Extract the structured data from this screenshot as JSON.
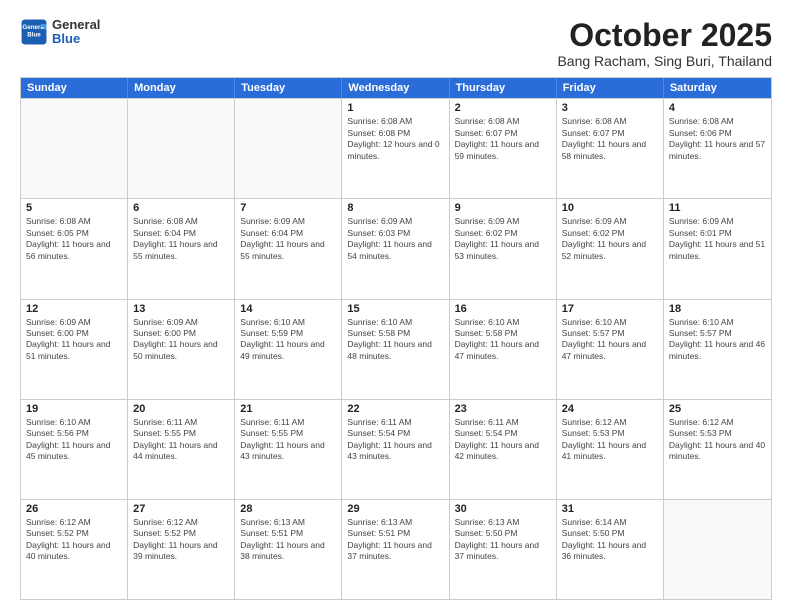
{
  "header": {
    "logo": {
      "general": "General",
      "blue": "Blue"
    },
    "title": "October 2025",
    "location": "Bang Racham, Sing Buri, Thailand"
  },
  "weekdays": [
    "Sunday",
    "Monday",
    "Tuesday",
    "Wednesday",
    "Thursday",
    "Friday",
    "Saturday"
  ],
  "weeks": [
    [
      {
        "day": "",
        "sunrise": "",
        "sunset": "",
        "daylight": "",
        "empty": true
      },
      {
        "day": "",
        "sunrise": "",
        "sunset": "",
        "daylight": "",
        "empty": true
      },
      {
        "day": "",
        "sunrise": "",
        "sunset": "",
        "daylight": "",
        "empty": true
      },
      {
        "day": "1",
        "sunrise": "Sunrise: 6:08 AM",
        "sunset": "Sunset: 6:08 PM",
        "daylight": "Daylight: 12 hours and 0 minutes.",
        "empty": false
      },
      {
        "day": "2",
        "sunrise": "Sunrise: 6:08 AM",
        "sunset": "Sunset: 6:07 PM",
        "daylight": "Daylight: 11 hours and 59 minutes.",
        "empty": false
      },
      {
        "day": "3",
        "sunrise": "Sunrise: 6:08 AM",
        "sunset": "Sunset: 6:07 PM",
        "daylight": "Daylight: 11 hours and 58 minutes.",
        "empty": false
      },
      {
        "day": "4",
        "sunrise": "Sunrise: 6:08 AM",
        "sunset": "Sunset: 6:06 PM",
        "daylight": "Daylight: 11 hours and 57 minutes.",
        "empty": false
      }
    ],
    [
      {
        "day": "5",
        "sunrise": "Sunrise: 6:08 AM",
        "sunset": "Sunset: 6:05 PM",
        "daylight": "Daylight: 11 hours and 56 minutes.",
        "empty": false
      },
      {
        "day": "6",
        "sunrise": "Sunrise: 6:08 AM",
        "sunset": "Sunset: 6:04 PM",
        "daylight": "Daylight: 11 hours and 55 minutes.",
        "empty": false
      },
      {
        "day": "7",
        "sunrise": "Sunrise: 6:09 AM",
        "sunset": "Sunset: 6:04 PM",
        "daylight": "Daylight: 11 hours and 55 minutes.",
        "empty": false
      },
      {
        "day": "8",
        "sunrise": "Sunrise: 6:09 AM",
        "sunset": "Sunset: 6:03 PM",
        "daylight": "Daylight: 11 hours and 54 minutes.",
        "empty": false
      },
      {
        "day": "9",
        "sunrise": "Sunrise: 6:09 AM",
        "sunset": "Sunset: 6:02 PM",
        "daylight": "Daylight: 11 hours and 53 minutes.",
        "empty": false
      },
      {
        "day": "10",
        "sunrise": "Sunrise: 6:09 AM",
        "sunset": "Sunset: 6:02 PM",
        "daylight": "Daylight: 11 hours and 52 minutes.",
        "empty": false
      },
      {
        "day": "11",
        "sunrise": "Sunrise: 6:09 AM",
        "sunset": "Sunset: 6:01 PM",
        "daylight": "Daylight: 11 hours and 51 minutes.",
        "empty": false
      }
    ],
    [
      {
        "day": "12",
        "sunrise": "Sunrise: 6:09 AM",
        "sunset": "Sunset: 6:00 PM",
        "daylight": "Daylight: 11 hours and 51 minutes.",
        "empty": false
      },
      {
        "day": "13",
        "sunrise": "Sunrise: 6:09 AM",
        "sunset": "Sunset: 6:00 PM",
        "daylight": "Daylight: 11 hours and 50 minutes.",
        "empty": false
      },
      {
        "day": "14",
        "sunrise": "Sunrise: 6:10 AM",
        "sunset": "Sunset: 5:59 PM",
        "daylight": "Daylight: 11 hours and 49 minutes.",
        "empty": false
      },
      {
        "day": "15",
        "sunrise": "Sunrise: 6:10 AM",
        "sunset": "Sunset: 5:58 PM",
        "daylight": "Daylight: 11 hours and 48 minutes.",
        "empty": false
      },
      {
        "day": "16",
        "sunrise": "Sunrise: 6:10 AM",
        "sunset": "Sunset: 5:58 PM",
        "daylight": "Daylight: 11 hours and 47 minutes.",
        "empty": false
      },
      {
        "day": "17",
        "sunrise": "Sunrise: 6:10 AM",
        "sunset": "Sunset: 5:57 PM",
        "daylight": "Daylight: 11 hours and 47 minutes.",
        "empty": false
      },
      {
        "day": "18",
        "sunrise": "Sunrise: 6:10 AM",
        "sunset": "Sunset: 5:57 PM",
        "daylight": "Daylight: 11 hours and 46 minutes.",
        "empty": false
      }
    ],
    [
      {
        "day": "19",
        "sunrise": "Sunrise: 6:10 AM",
        "sunset": "Sunset: 5:56 PM",
        "daylight": "Daylight: 11 hours and 45 minutes.",
        "empty": false
      },
      {
        "day": "20",
        "sunrise": "Sunrise: 6:11 AM",
        "sunset": "Sunset: 5:55 PM",
        "daylight": "Daylight: 11 hours and 44 minutes.",
        "empty": false
      },
      {
        "day": "21",
        "sunrise": "Sunrise: 6:11 AM",
        "sunset": "Sunset: 5:55 PM",
        "daylight": "Daylight: 11 hours and 43 minutes.",
        "empty": false
      },
      {
        "day": "22",
        "sunrise": "Sunrise: 6:11 AM",
        "sunset": "Sunset: 5:54 PM",
        "daylight": "Daylight: 11 hours and 43 minutes.",
        "empty": false
      },
      {
        "day": "23",
        "sunrise": "Sunrise: 6:11 AM",
        "sunset": "Sunset: 5:54 PM",
        "daylight": "Daylight: 11 hours and 42 minutes.",
        "empty": false
      },
      {
        "day": "24",
        "sunrise": "Sunrise: 6:12 AM",
        "sunset": "Sunset: 5:53 PM",
        "daylight": "Daylight: 11 hours and 41 minutes.",
        "empty": false
      },
      {
        "day": "25",
        "sunrise": "Sunrise: 6:12 AM",
        "sunset": "Sunset: 5:53 PM",
        "daylight": "Daylight: 11 hours and 40 minutes.",
        "empty": false
      }
    ],
    [
      {
        "day": "26",
        "sunrise": "Sunrise: 6:12 AM",
        "sunset": "Sunset: 5:52 PM",
        "daylight": "Daylight: 11 hours and 40 minutes.",
        "empty": false
      },
      {
        "day": "27",
        "sunrise": "Sunrise: 6:12 AM",
        "sunset": "Sunset: 5:52 PM",
        "daylight": "Daylight: 11 hours and 39 minutes.",
        "empty": false
      },
      {
        "day": "28",
        "sunrise": "Sunrise: 6:13 AM",
        "sunset": "Sunset: 5:51 PM",
        "daylight": "Daylight: 11 hours and 38 minutes.",
        "empty": false
      },
      {
        "day": "29",
        "sunrise": "Sunrise: 6:13 AM",
        "sunset": "Sunset: 5:51 PM",
        "daylight": "Daylight: 11 hours and 37 minutes.",
        "empty": false
      },
      {
        "day": "30",
        "sunrise": "Sunrise: 6:13 AM",
        "sunset": "Sunset: 5:50 PM",
        "daylight": "Daylight: 11 hours and 37 minutes.",
        "empty": false
      },
      {
        "day": "31",
        "sunrise": "Sunrise: 6:14 AM",
        "sunset": "Sunset: 5:50 PM",
        "daylight": "Daylight: 11 hours and 36 minutes.",
        "empty": false
      },
      {
        "day": "",
        "sunrise": "",
        "sunset": "",
        "daylight": "",
        "empty": true
      }
    ]
  ]
}
